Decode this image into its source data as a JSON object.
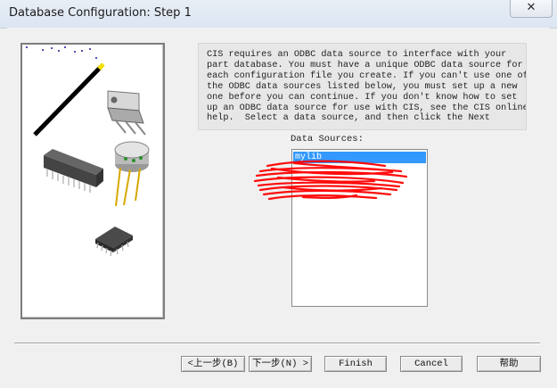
{
  "window": {
    "title": "Database Configuration: Step 1",
    "close_glyph": "✕"
  },
  "intro": {
    "lines": [
      "CIS requires an ODBC data source to interface with your",
      "part database. You must have a unique ODBC data source for",
      "each configuration file you create. If you can't use one of",
      "the ODBC data sources listed below, you must set up a new",
      "one before you can continue. If you don't know how to set",
      "up an ODBC data source for use with CIS, see the CIS online",
      "help.  Select a data source, and then click the Next"
    ]
  },
  "data_sources": {
    "label": "Data Sources:",
    "items": [
      "mylib"
    ],
    "selected": "mylib"
  },
  "buttons": {
    "prev": "<上一步(B)",
    "next": "下一步(N) >",
    "finish": "Finish",
    "cancel": "Cancel",
    "help": "帮助"
  },
  "icons": {
    "close": "close-icon",
    "illustration": "wizard-components-illustration"
  },
  "colors": {
    "selection": "#3399ff",
    "redaction": "#ff0000"
  }
}
